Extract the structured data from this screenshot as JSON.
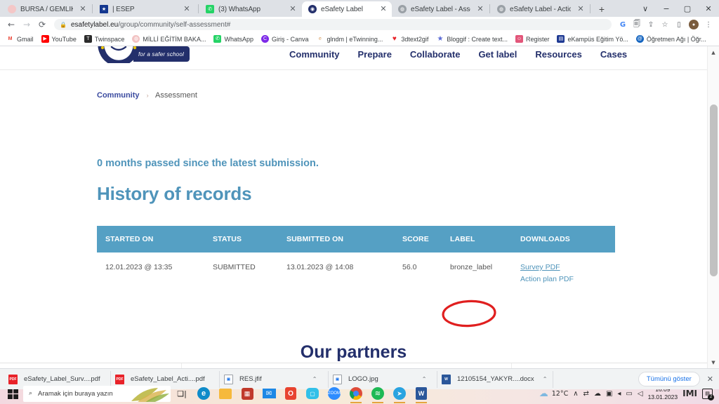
{
  "browser": {
    "tabs": [
      {
        "title": "BURSA / GEMLİK - Lale Ken",
        "favicon_color": "#f4c7c7",
        "favicon_glyph": "◉",
        "active": false
      },
      {
        "title": "| ESEP",
        "favicon_color": "#14378f",
        "favicon_glyph": "★",
        "active": false
      },
      {
        "title": "(3) WhatsApp",
        "favicon_color": "#25d366",
        "favicon_glyph": "✆",
        "active": false
      },
      {
        "title": "eSafety Label",
        "favicon_color": "#232f6b",
        "favicon_glyph": "◉",
        "active": true
      },
      {
        "title": "eSafety Label - Assessment",
        "favicon_color": "#9aa0a6",
        "favicon_glyph": "◍",
        "active": false
      },
      {
        "title": "eSafety Label - Action Plan",
        "favicon_color": "#9aa0a6",
        "favicon_glyph": "◍",
        "active": false
      }
    ],
    "new_tab_label": "+",
    "window_controls": {
      "minimize": "−",
      "maximize": "▢",
      "close": "✕",
      "chevron": "∨"
    },
    "nav": {
      "back": "←",
      "forward": "→",
      "reload": "⟳"
    },
    "omnibox": {
      "lock_icon": "🔒",
      "host": "esafetylabel.eu",
      "path": "/group/community/self-assessment#",
      "full_url": "esafetylabel.eu/group/community/self-assessment#"
    },
    "toolbar_icons": [
      {
        "name": "google-lens-icon",
        "glyph": "G"
      },
      {
        "name": "translate-icon",
        "glyph": "🗐"
      },
      {
        "name": "share-icon",
        "glyph": "⇪"
      },
      {
        "name": "bookmark-star-icon",
        "glyph": "☆"
      },
      {
        "name": "sidepanel-icon",
        "glyph": "▯"
      }
    ],
    "menu_icon": "⋮",
    "bookmarks": [
      {
        "label": "Gmail",
        "color": "#ea4335",
        "glyph": "M"
      },
      {
        "label": "YouTube",
        "color": "#ff0000",
        "glyph": "▶"
      },
      {
        "label": "Twinspace",
        "color": "#2b2b2b",
        "glyph": "T"
      },
      {
        "label": "MİLLİ EĞİTİM BAKA...",
        "color": "#f2c3c3",
        "glyph": "◍"
      },
      {
        "label": "WhatsApp",
        "color": "#25d366",
        "glyph": "✆"
      },
      {
        "label": "Giriş - Canva",
        "color": "#7d2ae8",
        "glyph": "C"
      },
      {
        "label": "glndm | eTwinning...",
        "color": "#d9a066",
        "glyph": "e"
      },
      {
        "label": "3dtext2gif",
        "color": "#e8232a",
        "glyph": "♥"
      },
      {
        "label": "Bloggif : Create text...",
        "color": "#5b6bd6",
        "glyph": "★"
      },
      {
        "label": "Register",
        "color": "#e2567a",
        "glyph": "☺"
      },
      {
        "label": "eKampüs Eğitim Yö...",
        "color": "#1f3a93",
        "glyph": "▤"
      },
      {
        "label": "Öğretmen Ağı | Öğr...",
        "color": "#1565c0",
        "glyph": "@"
      }
    ]
  },
  "page": {
    "logo": {
      "tagline": "for a safer school"
    },
    "nav_links": [
      {
        "label": "Community"
      },
      {
        "label": "Prepare"
      },
      {
        "label": "Collaborate"
      },
      {
        "label": "Get label"
      },
      {
        "label": "Resources"
      },
      {
        "label": "Cases"
      }
    ],
    "breadcrumb": {
      "root": "Community",
      "separator": "›",
      "current": "Assessment"
    },
    "submission_note": "0 months passed since the latest submission.",
    "section_title": "History of records",
    "table": {
      "columns": [
        "STARTED ON",
        "STATUS",
        "SUBMITTED ON",
        "SCORE",
        "LABEL",
        "DOWNLOADS"
      ],
      "rows": [
        {
          "started_on": "12.01.2023 @ 13:35",
          "status": "SUBMITTED",
          "submitted_on": "13.01.2023 @ 14:08",
          "score": "56.0",
          "label": "bronze_label",
          "downloads": [
            "Survey PDF",
            "Action plan PDF"
          ]
        }
      ]
    },
    "partners_title": "Our partners",
    "annotation": {
      "shape": "ellipse",
      "color": "#e01f1f",
      "targets": "bronze_label"
    },
    "colors": {
      "table_header_bg": "#55a0c4",
      "heading_blue": "#4f94ba",
      "navy": "#232f6b",
      "link_blue": "#4f94ba"
    }
  },
  "downloads_shelf": {
    "items": [
      {
        "name": "eSafety_Label_Surv....pdf",
        "type": "pdf",
        "caret": "⌃"
      },
      {
        "name": "eSafety_Label_Acti....pdf",
        "type": "pdf",
        "caret": "⌃"
      },
      {
        "name": "RES.jfif",
        "type": "image",
        "caret": "⌃"
      },
      {
        "name": "LOGO.jpg",
        "type": "image",
        "caret": "⌃"
      },
      {
        "name": "12105154_YAKYR....docx",
        "type": "doc",
        "caret": "⌃"
      }
    ],
    "show_all_label": "Tümünü göster",
    "close_label": "✕"
  },
  "taskbar": {
    "search_placeholder": "Aramak için buraya yazın",
    "search_icon": "⌕",
    "apps": [
      {
        "name": "task-view-icon",
        "glyph": "❐",
        "color": "#2b2b2b",
        "open": false
      },
      {
        "name": "edge-icon",
        "glyph": "e",
        "color": "#0f8bc9",
        "open": false
      },
      {
        "name": "file-explorer-icon",
        "glyph": "▤",
        "color": "#f6b93b",
        "open": false
      },
      {
        "name": "microsoft-store-icon",
        "glyph": "▦",
        "color": "#c0392b",
        "open": false
      },
      {
        "name": "mail-icon",
        "glyph": "✉",
        "color": "#1e88e5",
        "open": false
      },
      {
        "name": "office-icon",
        "glyph": "O",
        "color": "#e8432f",
        "open": false
      },
      {
        "name": "chat-icon",
        "glyph": "▢",
        "color": "#33c0e8",
        "open": false
      },
      {
        "name": "zoom-icon",
        "glyph": "z",
        "color": "#2d8cff",
        "open": false
      },
      {
        "name": "chrome-icon",
        "glyph": "◉",
        "color": "#dd4b39",
        "open": true
      },
      {
        "name": "spotify-icon",
        "glyph": "♫",
        "color": "#1db954",
        "open": true
      },
      {
        "name": "telegram-icon",
        "glyph": "➤",
        "color": "#2aa3e0",
        "open": true
      },
      {
        "name": "word-icon",
        "glyph": "W",
        "color": "#2b579a",
        "open": true
      }
    ],
    "weather": {
      "icon": "☁",
      "temperature": "12°C"
    },
    "tray_icons": [
      {
        "name": "tray-overflow-chevron-icon",
        "glyph": "∧"
      },
      {
        "name": "network-transfer-icon",
        "glyph": "⇄"
      },
      {
        "name": "onedrive-icon",
        "glyph": "☁"
      },
      {
        "name": "screen-capture-icon",
        "glyph": "▣"
      },
      {
        "name": "wifi-icon",
        "glyph": "◂"
      },
      {
        "name": "battery-icon",
        "glyph": "▭"
      },
      {
        "name": "volume-icon",
        "glyph": "◁"
      }
    ],
    "clock": {
      "time": "16:09",
      "date": "13.01.2023"
    },
    "notification_count": "2"
  }
}
